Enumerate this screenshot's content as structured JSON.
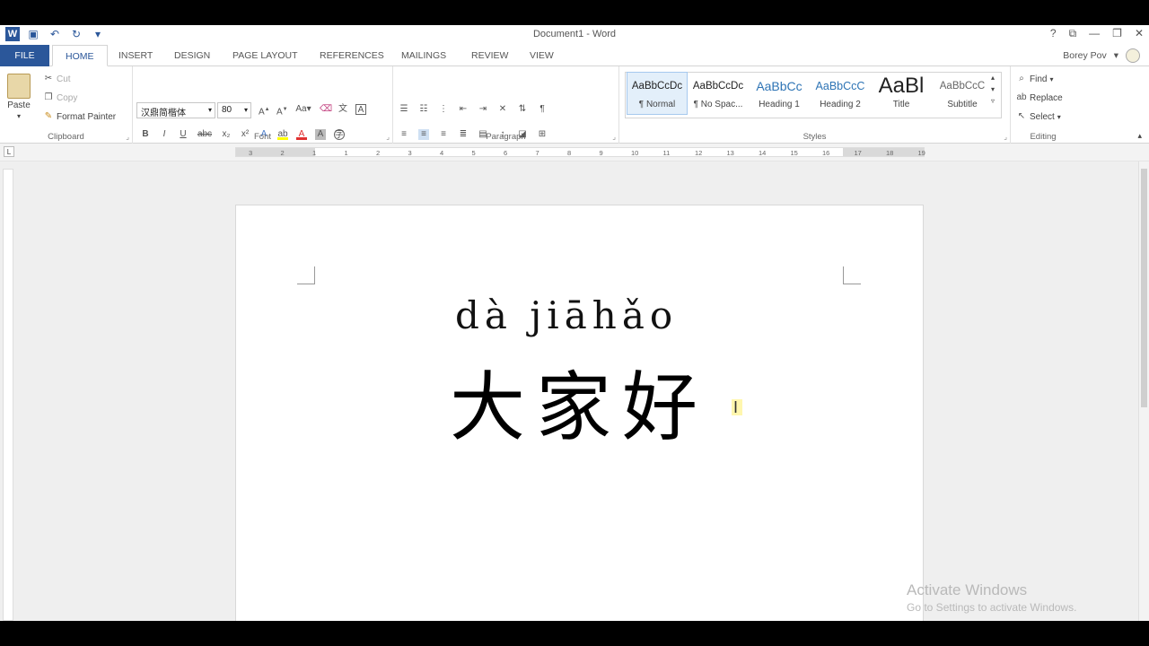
{
  "window": {
    "title": "Document1 - Word",
    "controls": [
      "?",
      "⧉",
      "—",
      "❐",
      "✕"
    ]
  },
  "quick_access": {
    "icons": [
      "word-logo",
      "save-icon",
      "undo-icon",
      "redo-icon",
      "customize-icon"
    ],
    "logo_letter": "W"
  },
  "tabs": [
    "FILE",
    "HOME",
    "INSERT",
    "DESIGN",
    "PAGE LAYOUT",
    "REFERENCES",
    "MAILINGS",
    "REVIEW",
    "VIEW"
  ],
  "active_tab": "HOME",
  "user": {
    "name": "Borey Pov"
  },
  "ribbon": {
    "clipboard": {
      "label": "Clipboard",
      "paste": "Paste",
      "cut": "Cut",
      "copy": "Copy",
      "format_painter": "Format Painter"
    },
    "font": {
      "label": "Font",
      "font_name": "汉鼎简楷体",
      "font_size": "80"
    },
    "paragraph": {
      "label": "Paragraph"
    },
    "styles": {
      "label": "Styles",
      "items": [
        {
          "preview": "AaBbCcDc",
          "name": "¶ Normal"
        },
        {
          "preview": "AaBbCcDc",
          "name": "¶ No Spac..."
        },
        {
          "preview": "AaBbCc",
          "name": "Heading 1"
        },
        {
          "preview": "AaBbCcC",
          "name": "Heading 2"
        },
        {
          "preview": "AaBl",
          "name": "Title"
        },
        {
          "preview": "AaBbCcC",
          "name": "Subtitle"
        }
      ]
    },
    "editing": {
      "label": "Editing",
      "find": "Find",
      "replace": "Replace",
      "select": "Select"
    }
  },
  "ruler": {
    "marks": [
      "3",
      "2",
      "1",
      "1",
      "2",
      "3",
      "4",
      "5",
      "6",
      "7",
      "8",
      "9",
      "10",
      "11",
      "12",
      "13",
      "14",
      "15",
      "16",
      "17",
      "18",
      "19"
    ]
  },
  "document": {
    "pinyin": "dà jiāhǎo",
    "text": "大家好"
  },
  "watermark": {
    "line1": "Activate Windows",
    "line2": "Go to Settings to activate Windows."
  },
  "colors": {
    "accent": "#2b579a",
    "highlight": "#ffff00",
    "font_color": "#e03030"
  }
}
